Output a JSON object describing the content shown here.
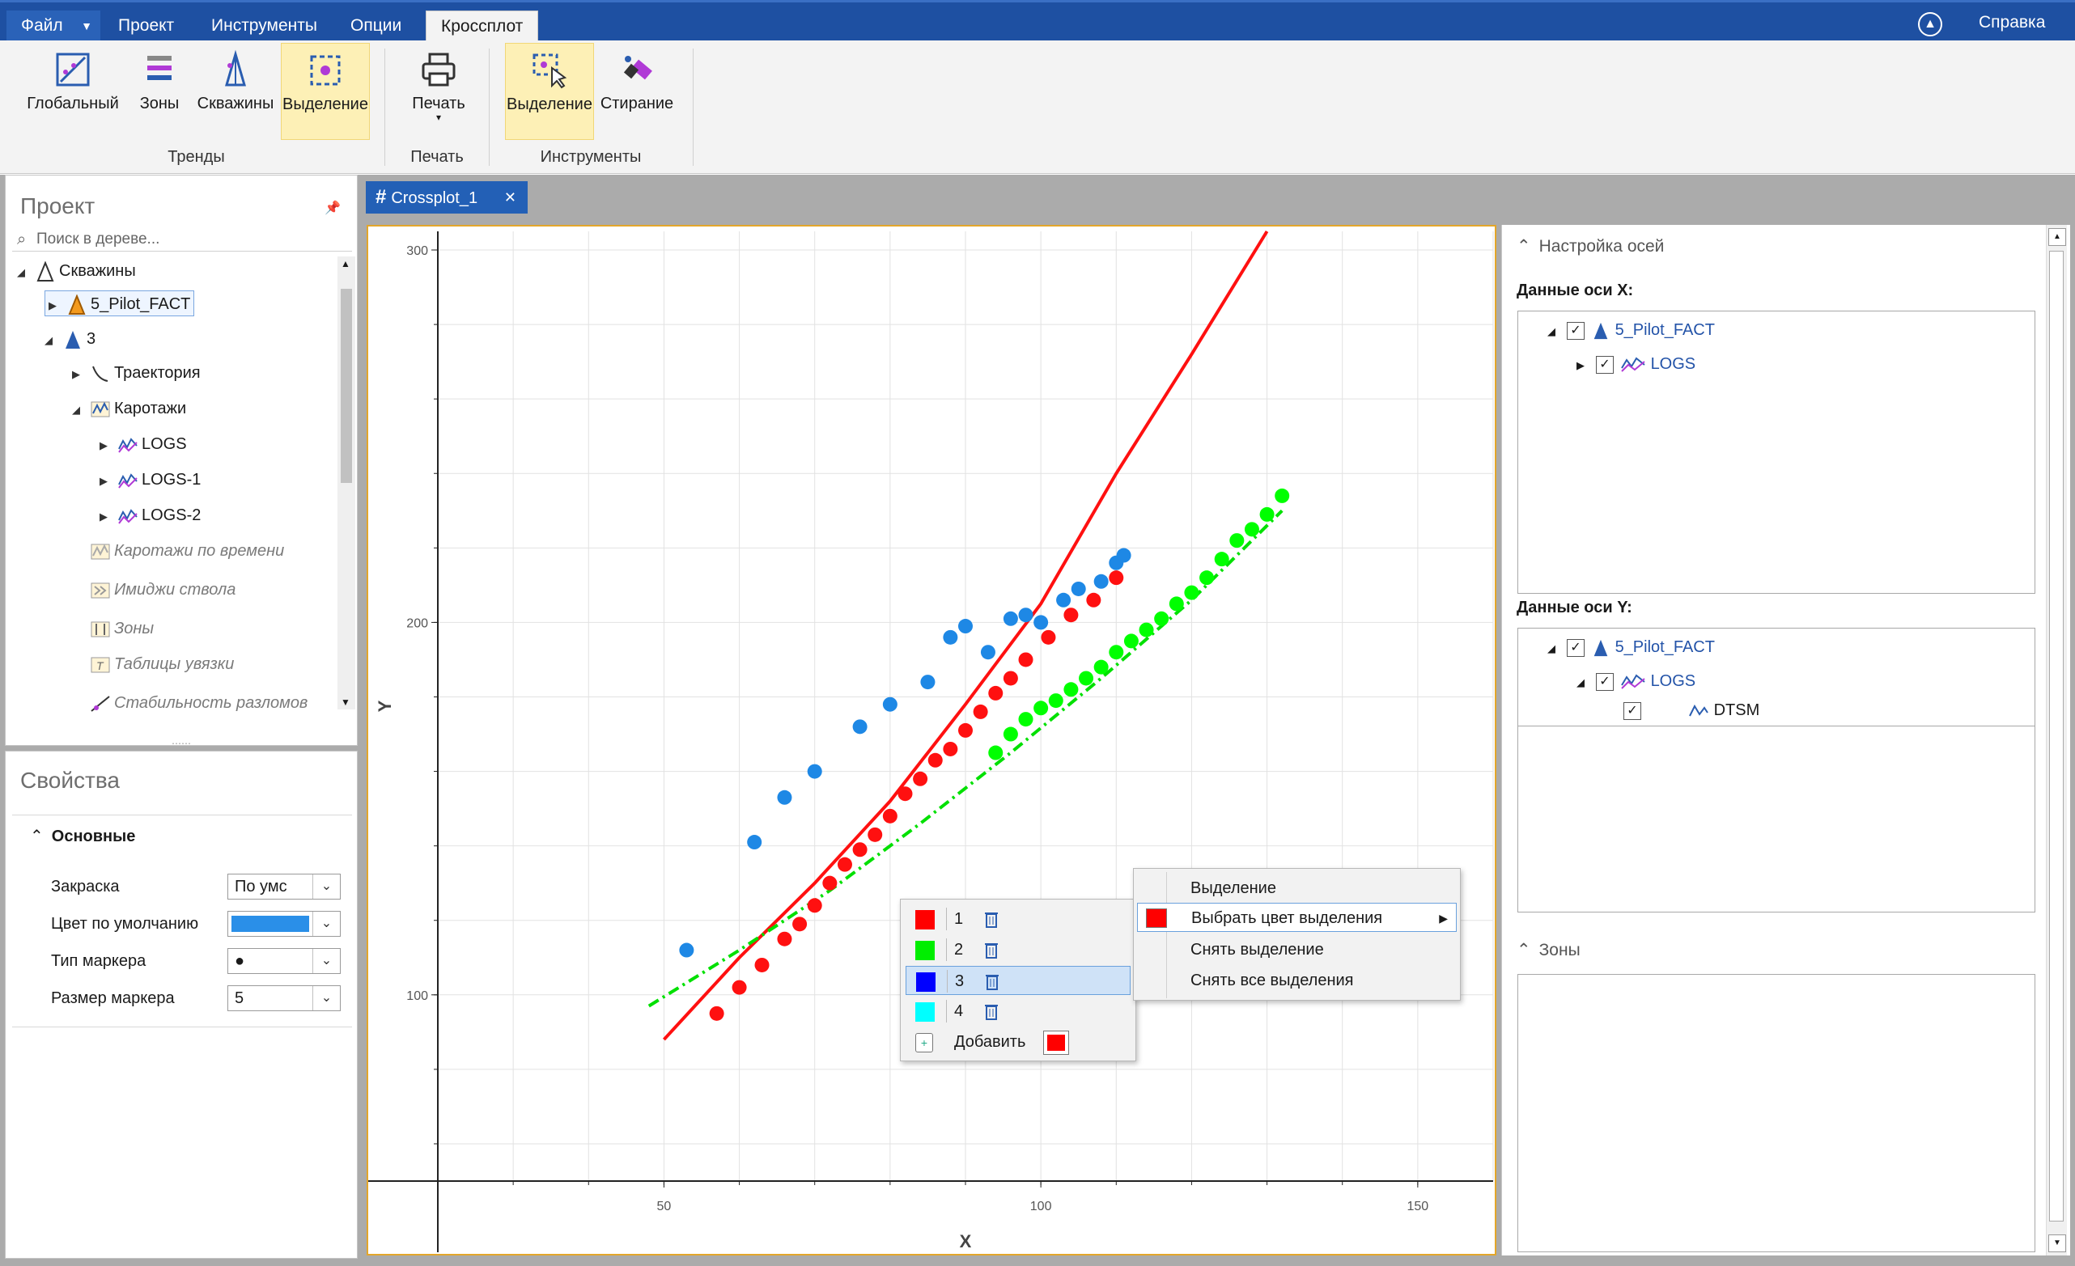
{
  "menu": {
    "file": "Файл",
    "project": "Проект",
    "tools": "Инструменты",
    "options": "Опции",
    "crossplot": "Кроссплот",
    "help": "Справка"
  },
  "ribbon": {
    "trends": {
      "global": "Глобальный",
      "zones": "Зоны",
      "wells": "Скважины",
      "selection": "Выделение",
      "group": "Тренды"
    },
    "print": {
      "print": "Печать",
      "group": "Печать"
    },
    "tools": {
      "selection": "Выделение",
      "erase": "Стирание",
      "group": "Инструменты"
    }
  },
  "project_panel": {
    "title": "Проект",
    "search_placeholder": "Поиск в дереве...",
    "tree": {
      "wells": "Скважины",
      "well1": "5_Pilot_FACT",
      "well2": "3",
      "trajectory": "Траектория",
      "logs_folder": "Каротажи",
      "logs": "LOGS",
      "logs1": "LOGS-1",
      "logs2": "LOGS-2",
      "time_logs": "Каротажи по времени",
      "borehole_images": "Имиджи ствола",
      "zones": "Зоны",
      "tie_tables": "Таблицы увязки",
      "fault_stability": "Стабильность разломов"
    }
  },
  "properties_panel": {
    "title": "Свойства",
    "section": "Основные",
    "fill_label": "Закраска",
    "fill_value": "По умс",
    "default_color_label": "Цвет по умолчанию",
    "default_color": "#2a8fe8",
    "marker_type_label": "Тип маркера",
    "marker_type_value": "●",
    "marker_size_label": "Размер маркера",
    "marker_size_value": "5"
  },
  "document_tab": {
    "title": "Crossplot_1"
  },
  "chart_data": {
    "type": "scatter",
    "xlabel": "X",
    "ylabel": "Y",
    "xlim": [
      20,
      160
    ],
    "ylim": [
      50,
      305
    ],
    "xticks": [
      50,
      100,
      150
    ],
    "yticks": [
      100,
      200,
      300
    ],
    "grid": true,
    "series": [
      {
        "color": "#1e88e5",
        "points": [
          [
            53,
            112
          ],
          [
            62,
            141
          ],
          [
            66,
            153
          ],
          [
            70,
            160
          ],
          [
            76,
            172
          ],
          [
            80,
            178
          ],
          [
            85,
            184
          ],
          [
            88,
            196
          ],
          [
            90,
            199
          ],
          [
            93,
            192
          ],
          [
            96,
            201
          ],
          [
            98,
            202
          ],
          [
            100,
            200
          ],
          [
            103,
            206
          ],
          [
            105,
            209
          ],
          [
            108,
            211
          ],
          [
            110,
            216
          ],
          [
            111,
            218
          ]
        ]
      },
      {
        "color": "#ff1010",
        "points": [
          [
            57,
            95
          ],
          [
            60,
            102
          ],
          [
            63,
            108
          ],
          [
            66,
            115
          ],
          [
            68,
            119
          ],
          [
            70,
            124
          ],
          [
            72,
            130
          ],
          [
            74,
            135
          ],
          [
            76,
            139
          ],
          [
            78,
            143
          ],
          [
            80,
            148
          ],
          [
            82,
            154
          ],
          [
            84,
            158
          ],
          [
            86,
            163
          ],
          [
            88,
            166
          ],
          [
            90,
            171
          ],
          [
            92,
            176
          ],
          [
            94,
            181
          ],
          [
            96,
            185
          ],
          [
            98,
            190
          ],
          [
            101,
            196
          ],
          [
            104,
            202
          ],
          [
            107,
            206
          ],
          [
            110,
            212
          ]
        ]
      },
      {
        "color": "#00ff00",
        "points": [
          [
            94,
            165
          ],
          [
            96,
            170
          ],
          [
            98,
            174
          ],
          [
            100,
            177
          ],
          [
            102,
            179
          ],
          [
            104,
            182
          ],
          [
            106,
            185
          ],
          [
            108,
            188
          ],
          [
            110,
            192
          ],
          [
            112,
            195
          ],
          [
            114,
            198
          ],
          [
            116,
            201
          ],
          [
            118,
            205
          ],
          [
            120,
            208
          ],
          [
            122,
            212
          ],
          [
            124,
            217
          ],
          [
            126,
            222
          ],
          [
            128,
            225
          ],
          [
            130,
            229
          ],
          [
            132,
            234
          ]
        ]
      }
    ],
    "trend_lines": [
      {
        "color": "#ff1010",
        "style": "solid",
        "points": [
          [
            50,
            88
          ],
          [
            60,
            110
          ],
          [
            70,
            130
          ],
          [
            80,
            152
          ],
          [
            90,
            178
          ],
          [
            100,
            205
          ],
          [
            110,
            240
          ],
          [
            120,
            272
          ],
          [
            130,
            305
          ]
        ]
      },
      {
        "color": "#00e000",
        "style": "dashed",
        "points": [
          [
            48,
            97
          ],
          [
            60,
            112
          ],
          [
            72,
            128
          ],
          [
            84,
            146
          ],
          [
            96,
            165
          ],
          [
            108,
            185
          ],
          [
            120,
            206
          ],
          [
            132,
            230
          ]
        ]
      }
    ]
  },
  "selection_popup": {
    "rows": [
      {
        "num": "1",
        "color": "#ff0000"
      },
      {
        "num": "2",
        "color": "#00ee00"
      },
      {
        "num": "3",
        "color": "#0000ff"
      },
      {
        "num": "4",
        "color": "#00ffff"
      }
    ],
    "add_label": "Добавить",
    "add_color": "#ff0000"
  },
  "context_menu": {
    "items": [
      "Выделение",
      "Выбрать цвет выделения",
      "Снять выделение",
      "Снять все выделения"
    ],
    "swatch_color": "#ff0000"
  },
  "axis_settings": {
    "title": "Настройка осей",
    "x_label": "Данные оси X:",
    "y_label": "Данные оси Y:",
    "well": "5_Pilot_FACT",
    "logs": "LOGS",
    "curve": "DTSM",
    "zones_title": "Зоны"
  }
}
